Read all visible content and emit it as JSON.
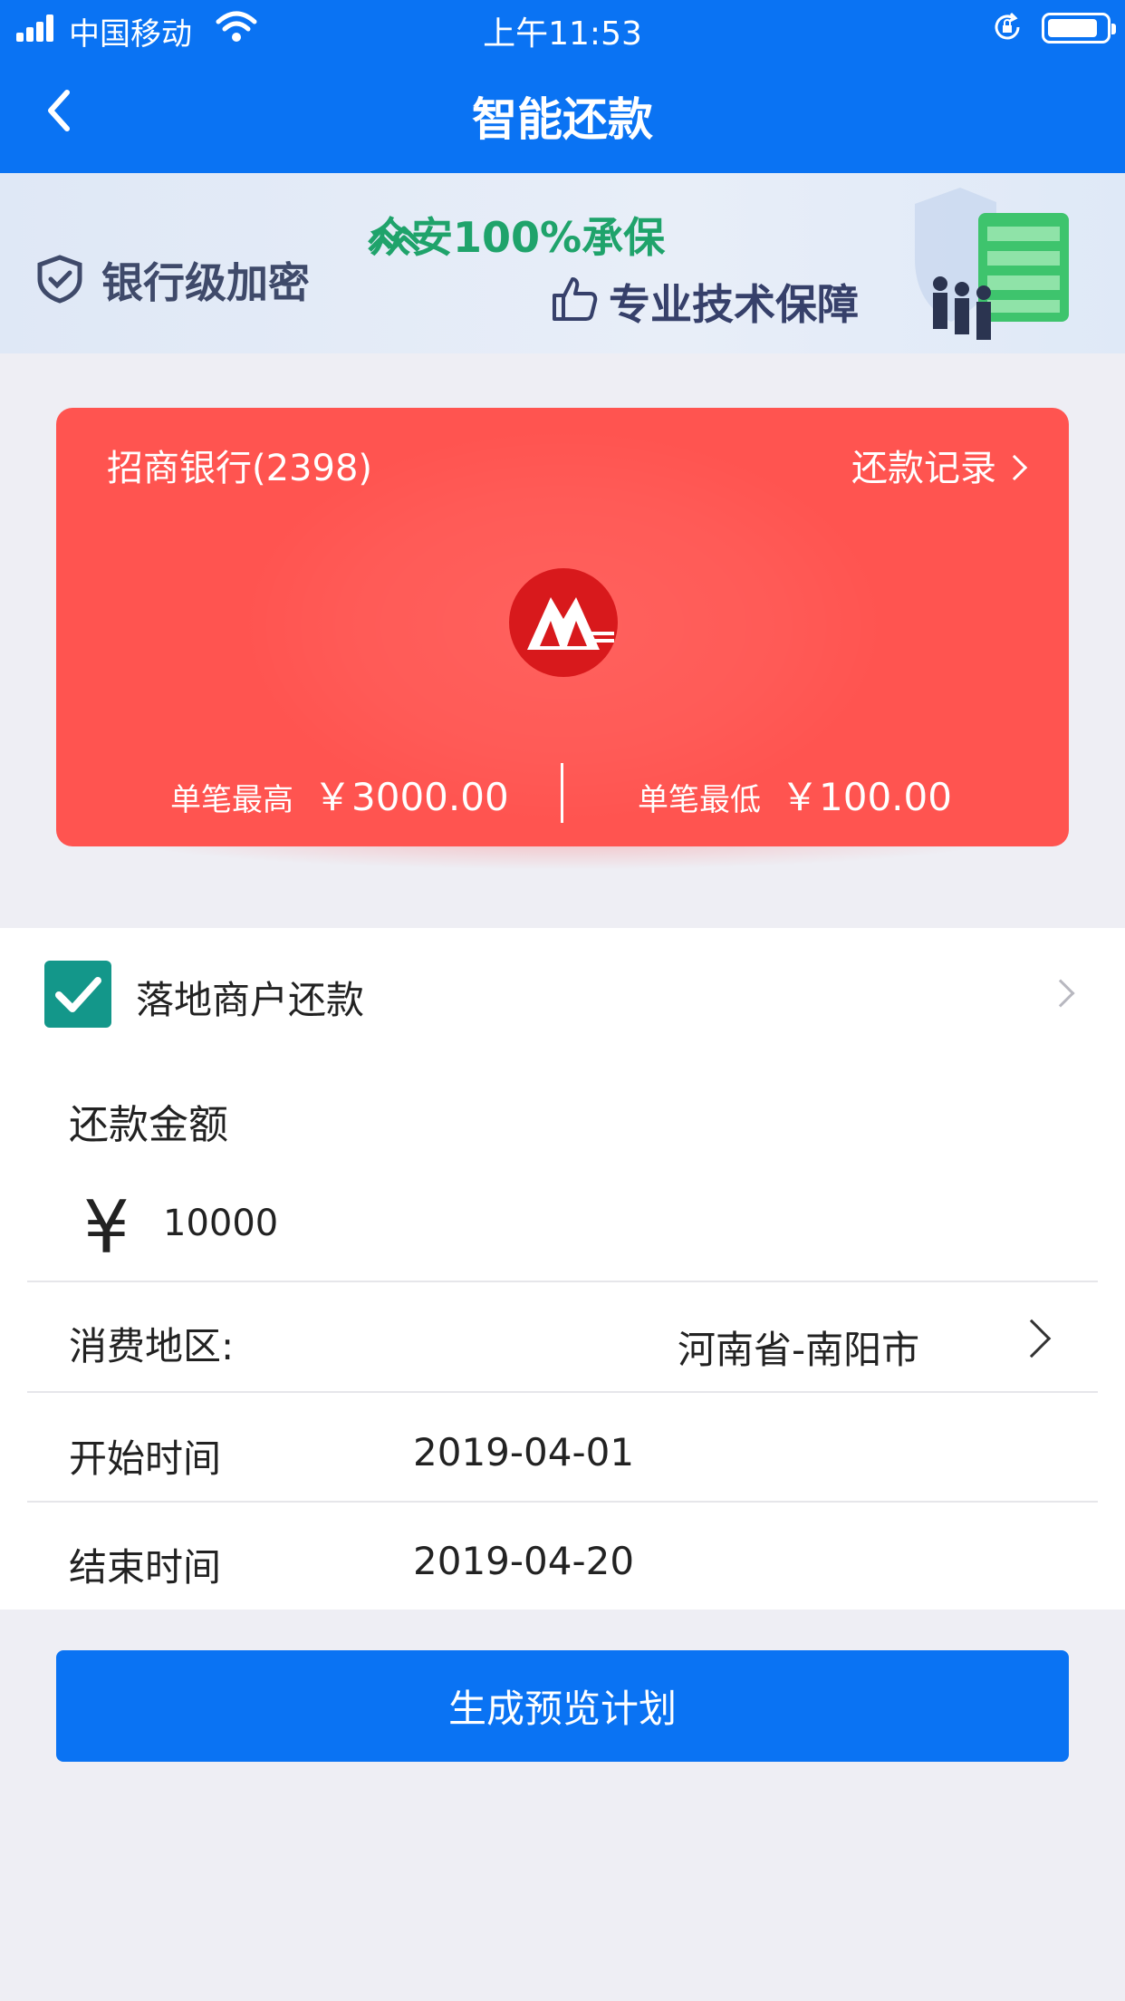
{
  "status_bar": {
    "carrier": "中国移动",
    "time": "上午11:53"
  },
  "nav": {
    "title": "智能还款",
    "back_icon": "chevron-left-icon"
  },
  "banner": {
    "encryption_text": "银行级加密",
    "zhongan_text": "众安100%承保",
    "tech_text": "专业技术保障"
  },
  "card": {
    "bank_name": "招商银行(2398)",
    "records_label": "还款记录",
    "max_label": "单笔最高",
    "max_value": "￥3000.00",
    "min_label": "单笔最低",
    "min_value": "￥100.00",
    "color": "#ff5450"
  },
  "form": {
    "merchant_label": "落地商户还款",
    "merchant_checked": true,
    "amount_label": "还款金额",
    "currency_symbol": "¥",
    "amount_value": "10000",
    "region_label": "消费地区:",
    "region_value": "河南省-南阳市",
    "start_label": "开始时间",
    "start_value": "2019-04-01",
    "end_label": "结束时间",
    "end_value": "2019-04-20"
  },
  "actions": {
    "generate_label": "生成预览计划"
  },
  "colors": {
    "primary": "#0a73f3",
    "checkbox": "#13978a",
    "background": "#eeeef4"
  }
}
